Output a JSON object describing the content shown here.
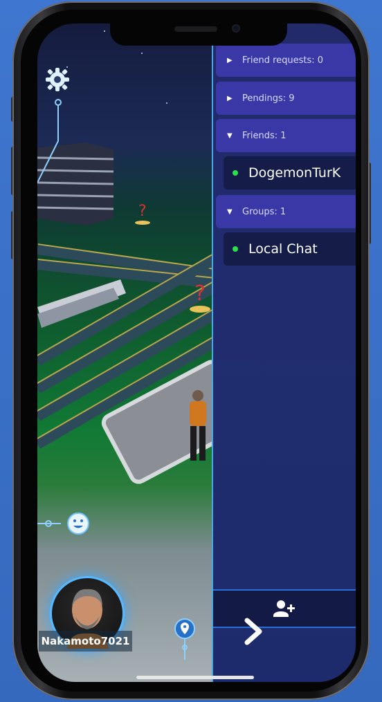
{
  "panel": {
    "sections": [
      {
        "label": "Friend requests: 0",
        "expanded": false
      },
      {
        "label": "Pendings: 9",
        "expanded": false
      },
      {
        "label": "Friends: 1",
        "expanded": true
      },
      {
        "label": "Groups: 1",
        "expanded": true
      }
    ],
    "friends": [
      {
        "name": "DogemonTurK",
        "status": "online"
      }
    ],
    "groups": [
      {
        "name": "Local Chat",
        "status": "online"
      }
    ],
    "add_friend_icon": "add-user-icon",
    "next_icon": "chevron-right-icon",
    "triangle_collapsed": "▶",
    "triangle_expanded": "▼"
  },
  "player": {
    "username": "Nakamoto7021"
  },
  "colors": {
    "online": "#2ce04a",
    "section_bg": "#3a38a7",
    "item_bg": "#151c47",
    "accent": "#4aa7e6"
  }
}
